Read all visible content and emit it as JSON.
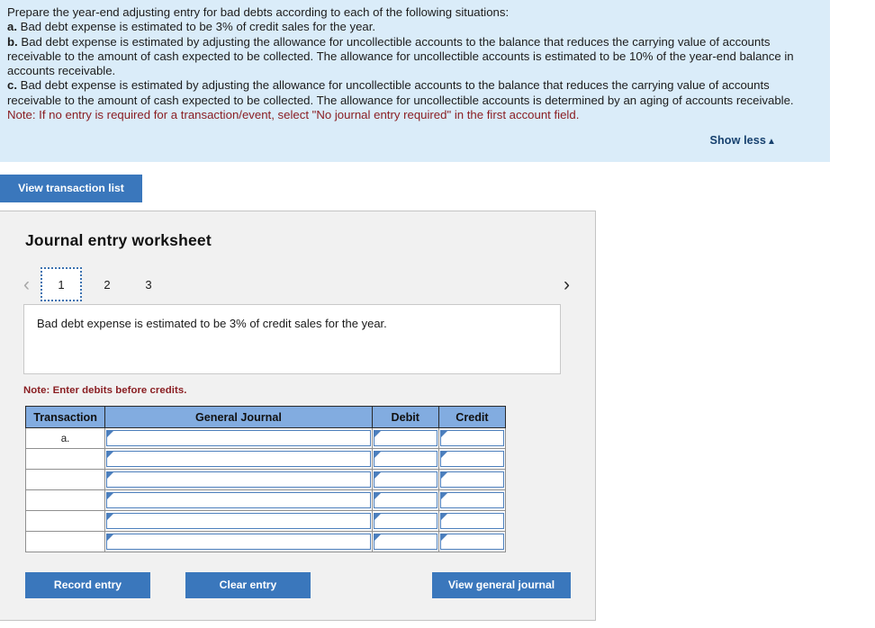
{
  "instructions": {
    "intro": "Prepare the year-end adjusting entry for bad debts according to each of the following situations:",
    "items": [
      {
        "label": "a.",
        "text": "Bad debt expense is estimated to be 3% of credit sales for the year."
      },
      {
        "label": "b.",
        "text": "Bad debt expense is estimated by adjusting the allowance for uncollectible accounts to the balance that reduces the carrying value of accounts receivable to the amount of cash expected to be collected. The allowance for uncollectible accounts is estimated to be 10% of the year-end balance in accounts receivable."
      },
      {
        "label": "c.",
        "text": "Bad debt expense is estimated by adjusting the allowance for uncollectible accounts to the balance that reduces the carrying value of accounts receivable to the amount of cash expected to be collected. The allowance for uncollectible accounts is determined by an aging of accounts receivable."
      }
    ],
    "note": "Note: If no entry is required for a transaction/event, select \"No journal entry required\" in the first account field.",
    "show_less_label": "Show less",
    "show_less_caret": "▲",
    "background_color": "#daecf9"
  },
  "toolbar": {
    "view_transaction_list_label": "View transaction list"
  },
  "worksheet": {
    "title": "Journal entry worksheet",
    "nav": {
      "prev_glyph": "‹",
      "next_glyph": "›"
    },
    "tabs": [
      {
        "label": "1",
        "active": true
      },
      {
        "label": "2",
        "active": false
      },
      {
        "label": "3",
        "active": false
      }
    ],
    "description": "Bad debt expense is estimated to be 3% of credit sales for the year.",
    "note_debits": "Note: Enter debits before credits.",
    "table": {
      "headers": [
        "Transaction",
        "General Journal",
        "Debit",
        "Credit"
      ],
      "rows": [
        {
          "transaction": "a.",
          "general_journal": "",
          "debit": "",
          "credit": ""
        },
        {
          "transaction": "",
          "general_journal": "",
          "debit": "",
          "credit": ""
        },
        {
          "transaction": "",
          "general_journal": "",
          "debit": "",
          "credit": ""
        },
        {
          "transaction": "",
          "general_journal": "",
          "debit": "",
          "credit": ""
        },
        {
          "transaction": "",
          "general_journal": "",
          "debit": "",
          "credit": ""
        },
        {
          "transaction": "",
          "general_journal": "",
          "debit": "",
          "credit": ""
        }
      ]
    },
    "footer": {
      "record_entry_label": "Record entry",
      "clear_entry_label": "Clear entry",
      "view_general_journal_label": "View general journal"
    }
  },
  "colors": {
    "panel_blue": "#daecf9",
    "button_blue": "#3a77bc",
    "table_header_blue": "#82ace0",
    "note_red": "#8a1f23",
    "link_blue": "#16406e"
  }
}
